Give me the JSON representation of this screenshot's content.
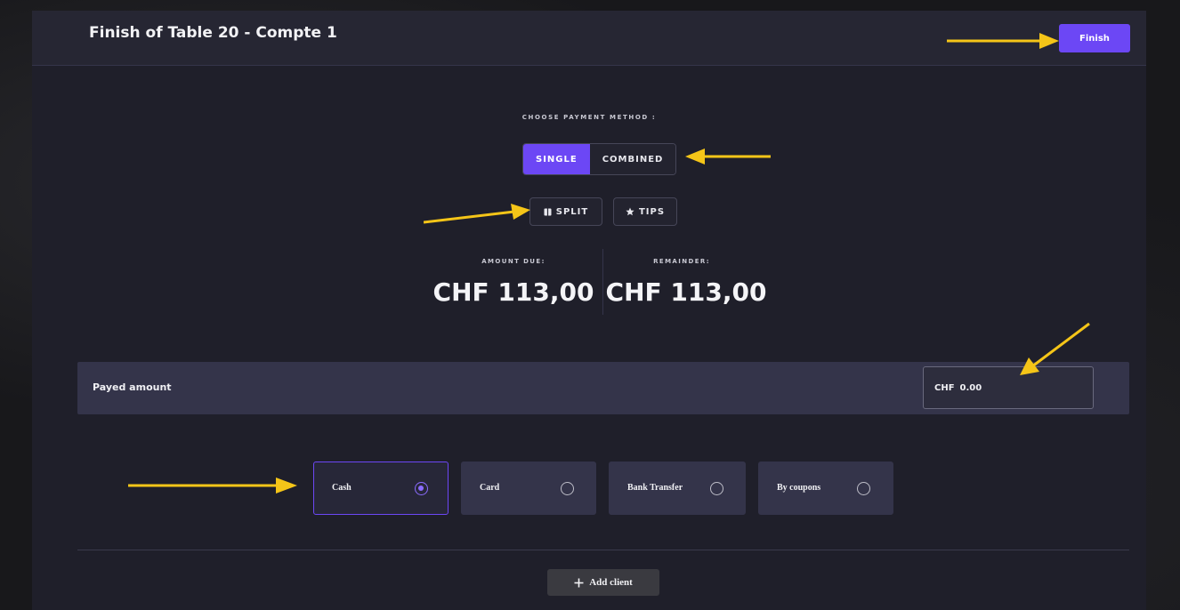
{
  "header": {
    "title": "Finish of Table 20 - Compte 1",
    "finish_label": "Finish"
  },
  "payment_method": {
    "label": "CHOOSE PAYMENT METHOD :",
    "modes": [
      {
        "label": "SINGLE",
        "active": true
      },
      {
        "label": "COMBINED",
        "active": false
      }
    ]
  },
  "actions": {
    "split_label": "SPLIT",
    "tips_label": "TIPS"
  },
  "amounts": {
    "due_label": "AMOUNT DUE:",
    "due_value": "CHF 113,00",
    "remainder_label": "REMAINDER:",
    "remainder_value": "CHF 113,00"
  },
  "payed": {
    "label": "Payed amount",
    "currency": "CHF",
    "value": "0.00"
  },
  "methods": [
    {
      "label": "Cash",
      "selected": true
    },
    {
      "label": "Card",
      "selected": false
    },
    {
      "label": "Bank Transfer",
      "selected": false
    },
    {
      "label": "By coupons",
      "selected": false
    }
  ],
  "add_client_label": "Add client",
  "colors": {
    "accent": "#6c47f5",
    "annotation_arrow": "#f5c518",
    "panel": "#1f1f2a",
    "field": "#34344a"
  },
  "icons": {
    "split": "split-icon",
    "tips": "star-icon",
    "add": "plus-icon"
  }
}
